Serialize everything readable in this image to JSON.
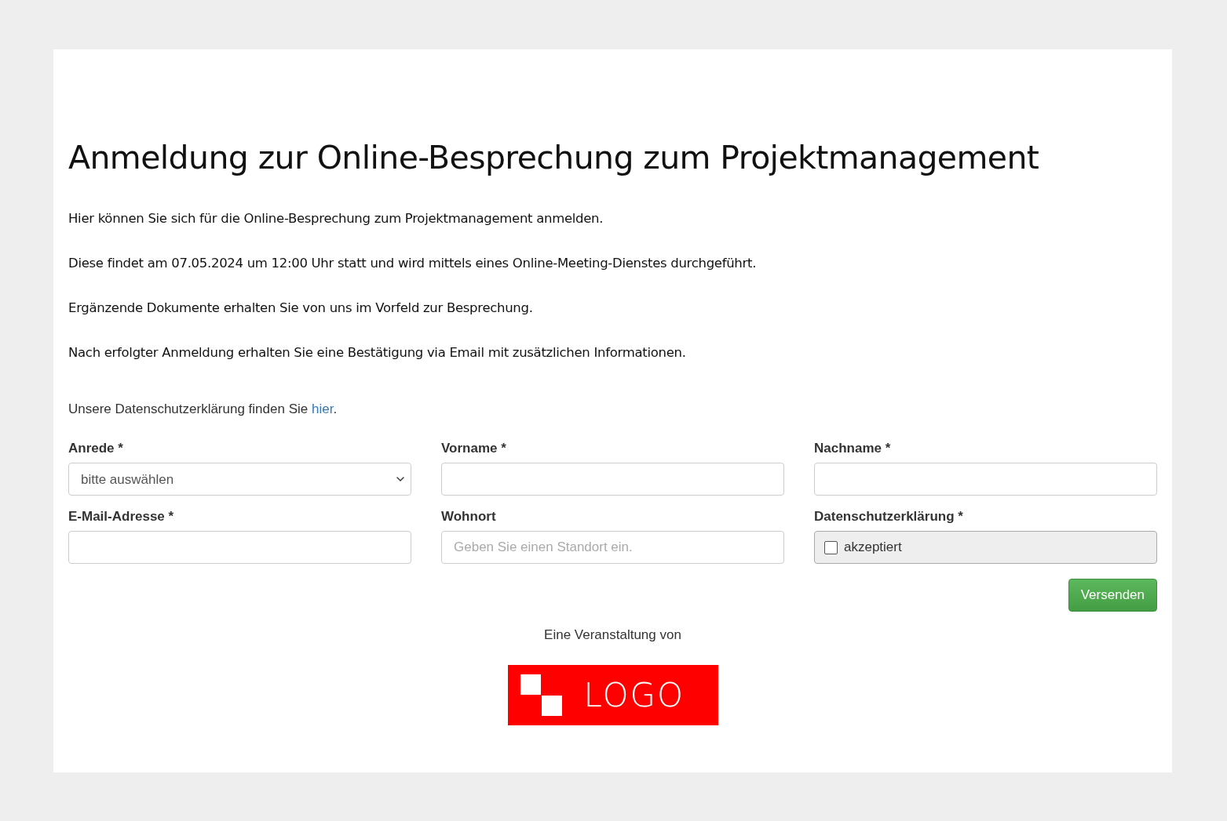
{
  "title": "Anmeldung zur Online-Besprechung zum Projektmanagement",
  "paragraphs": [
    "Hier können Sie sich für die Online-Besprechung zum Projektmanagement anmelden.",
    "Diese findet am 07.05.2024 um 12:00 Uhr statt und wird mittels eines Online-Meeting-Dienstes durchgeführt.",
    "Ergänzende Dokumente erhalten Sie von uns im Vorfeld zur Besprechung.",
    "Nach erfolgter Anmeldung erhalten Sie eine Bestätigung via Email mit zusätzlichen Informationen."
  ],
  "privacy": {
    "before": "Unsere Datenschutzerklärung finden Sie",
    "link": "hier",
    "after": "."
  },
  "fields": [
    {
      "kind": "select",
      "label": "Anrede *",
      "value": "bitte auswählen"
    },
    {
      "kind": "text",
      "label": "Vorname *"
    },
    {
      "kind": "text",
      "label": "Nachname *"
    },
    {
      "kind": "text",
      "label": "E-Mail-Adresse *"
    },
    {
      "kind": "text",
      "label": "Wohnort",
      "placeholder": "Geben Sie einen Standort ein."
    },
    {
      "kind": "checkbox",
      "label": "Datenschutzerklärung *",
      "option": "akzeptiert",
      "checked": false
    }
  ],
  "submit": "Versenden",
  "footer": {
    "text": "Eine Veranstaltung von",
    "logo": "LOGO"
  }
}
